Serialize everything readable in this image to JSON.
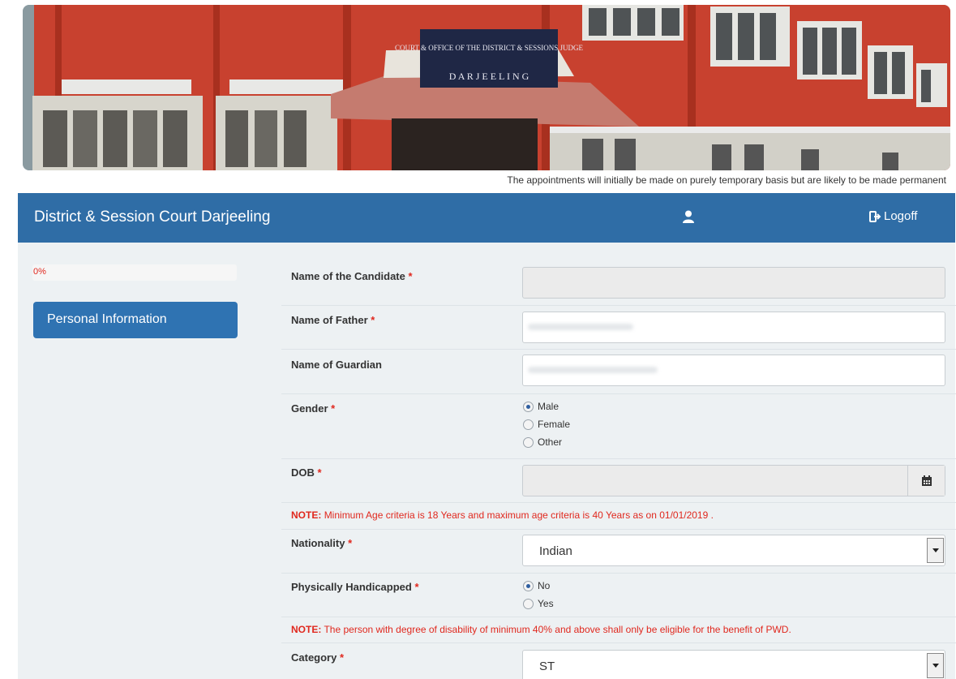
{
  "banner": {
    "sign_line1": "COURT & OFFICE OF THE DISTRICT & SESSIONS JUDGE",
    "sign_line2": "D A R J E E L I N G"
  },
  "caption": "The appointments will initially be made on purely temporary basis but are likely to be made permanent",
  "header": {
    "title": "District & Session Court Darjeeling",
    "user_icon": "user-icon",
    "logoff_icon": "logoff-icon",
    "logoff_label": "Logoff"
  },
  "sidebar": {
    "progress_text": "0%",
    "progress_value": 0,
    "nav_item": "Personal Information"
  },
  "form": {
    "candidate_name": {
      "label": "Name of the Candidate",
      "required": "*",
      "value": ""
    },
    "father_name": {
      "label": "Name of Father",
      "required": "*",
      "value": ""
    },
    "guardian_name": {
      "label": "Name of Guardian",
      "value": ""
    },
    "gender": {
      "label": "Gender",
      "required": "*",
      "options": [
        "Male",
        "Female",
        "Other"
      ],
      "selected": "Male"
    },
    "dob": {
      "label": "DOB",
      "required": "*",
      "value": "",
      "icon": "calendar-icon"
    },
    "note_age": {
      "prefix": "NOTE:",
      "text": "Minimum Age criteria is 18 Years and maximum age criteria is 40 Years as on 01/01/2019 ."
    },
    "nationality": {
      "label": "Nationality",
      "required": "*",
      "value": "Indian"
    },
    "handicapped": {
      "label": "Physically Handicapped",
      "required": "*",
      "options": [
        "No",
        "Yes"
      ],
      "selected": "No"
    },
    "note_pwd": {
      "prefix": "NOTE:",
      "text": "The person with degree of disability of minimum 40% and above shall only be eligible for the benefit of PWD."
    },
    "category": {
      "label": "Category",
      "required": "*",
      "value": "ST"
    }
  },
  "colors": {
    "header_bg": "#2f6da6",
    "nav_bg": "#2f73b2",
    "required": "#e0281e",
    "panel_bg": "#edf1f3"
  }
}
